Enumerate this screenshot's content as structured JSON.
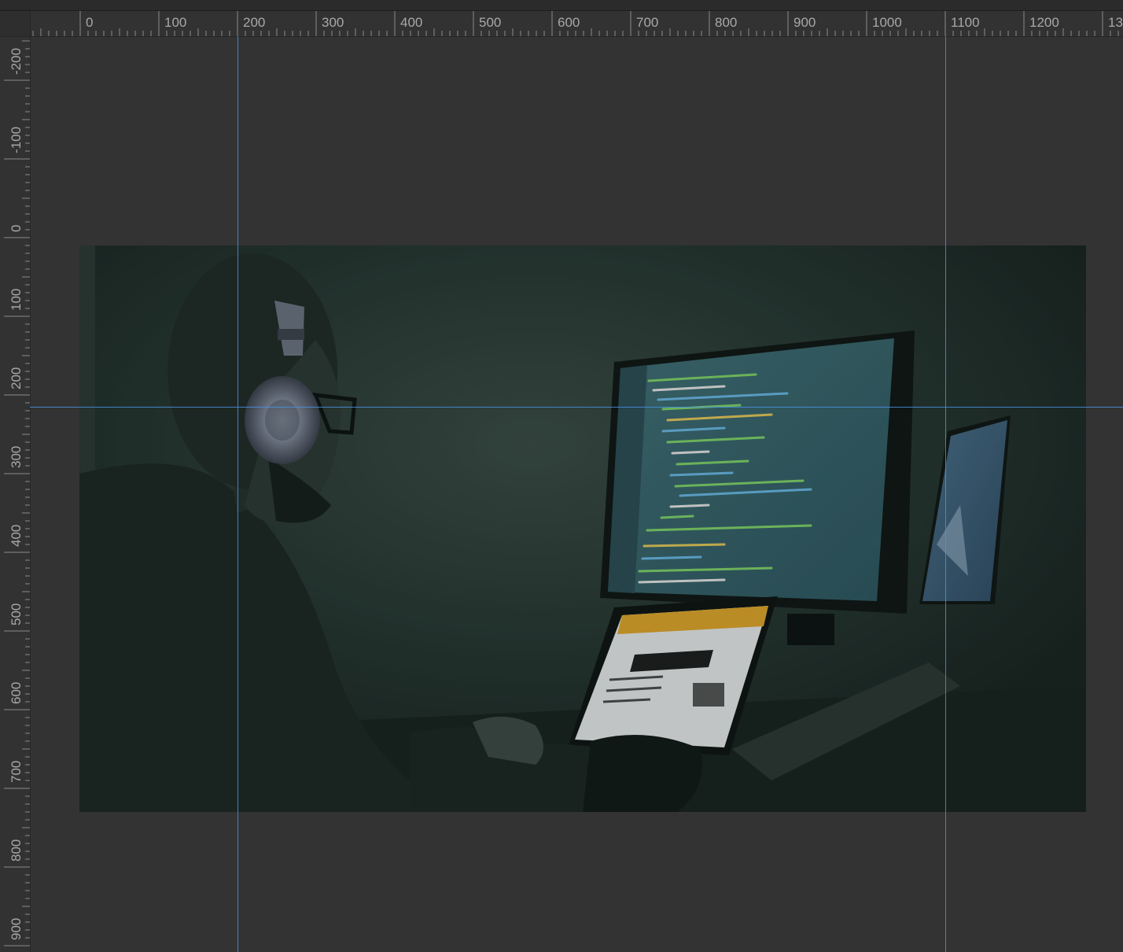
{
  "rulers": {
    "horizontal": {
      "labels": [
        "0",
        "100",
        "200",
        "300",
        "400",
        "500",
        "600",
        "700",
        "800",
        "900",
        "1000",
        "1100",
        "1200",
        "13"
      ]
    },
    "vertical": {
      "labels": [
        "-200",
        "-100",
        "0",
        "100",
        "200",
        "300",
        "400",
        "500",
        "600",
        "700",
        "800",
        "900"
      ]
    }
  },
  "guides": {
    "vertical": [
      200,
      1100
    ],
    "horizontal": [
      215
    ]
  },
  "artboard": {
    "description_icon": "photo-image",
    "dominant_color": "#1f2e2b",
    "screen_color": "#3a6a72",
    "code_colors": [
      "#7fd46a",
      "#e6c85a",
      "#6ab8e6",
      "#e6e6e6"
    ],
    "laptop_banner_color": "#e0a52a"
  },
  "colors": {
    "workspace": "#333333",
    "ruler": "#323232",
    "guide": "#4a90e2"
  }
}
